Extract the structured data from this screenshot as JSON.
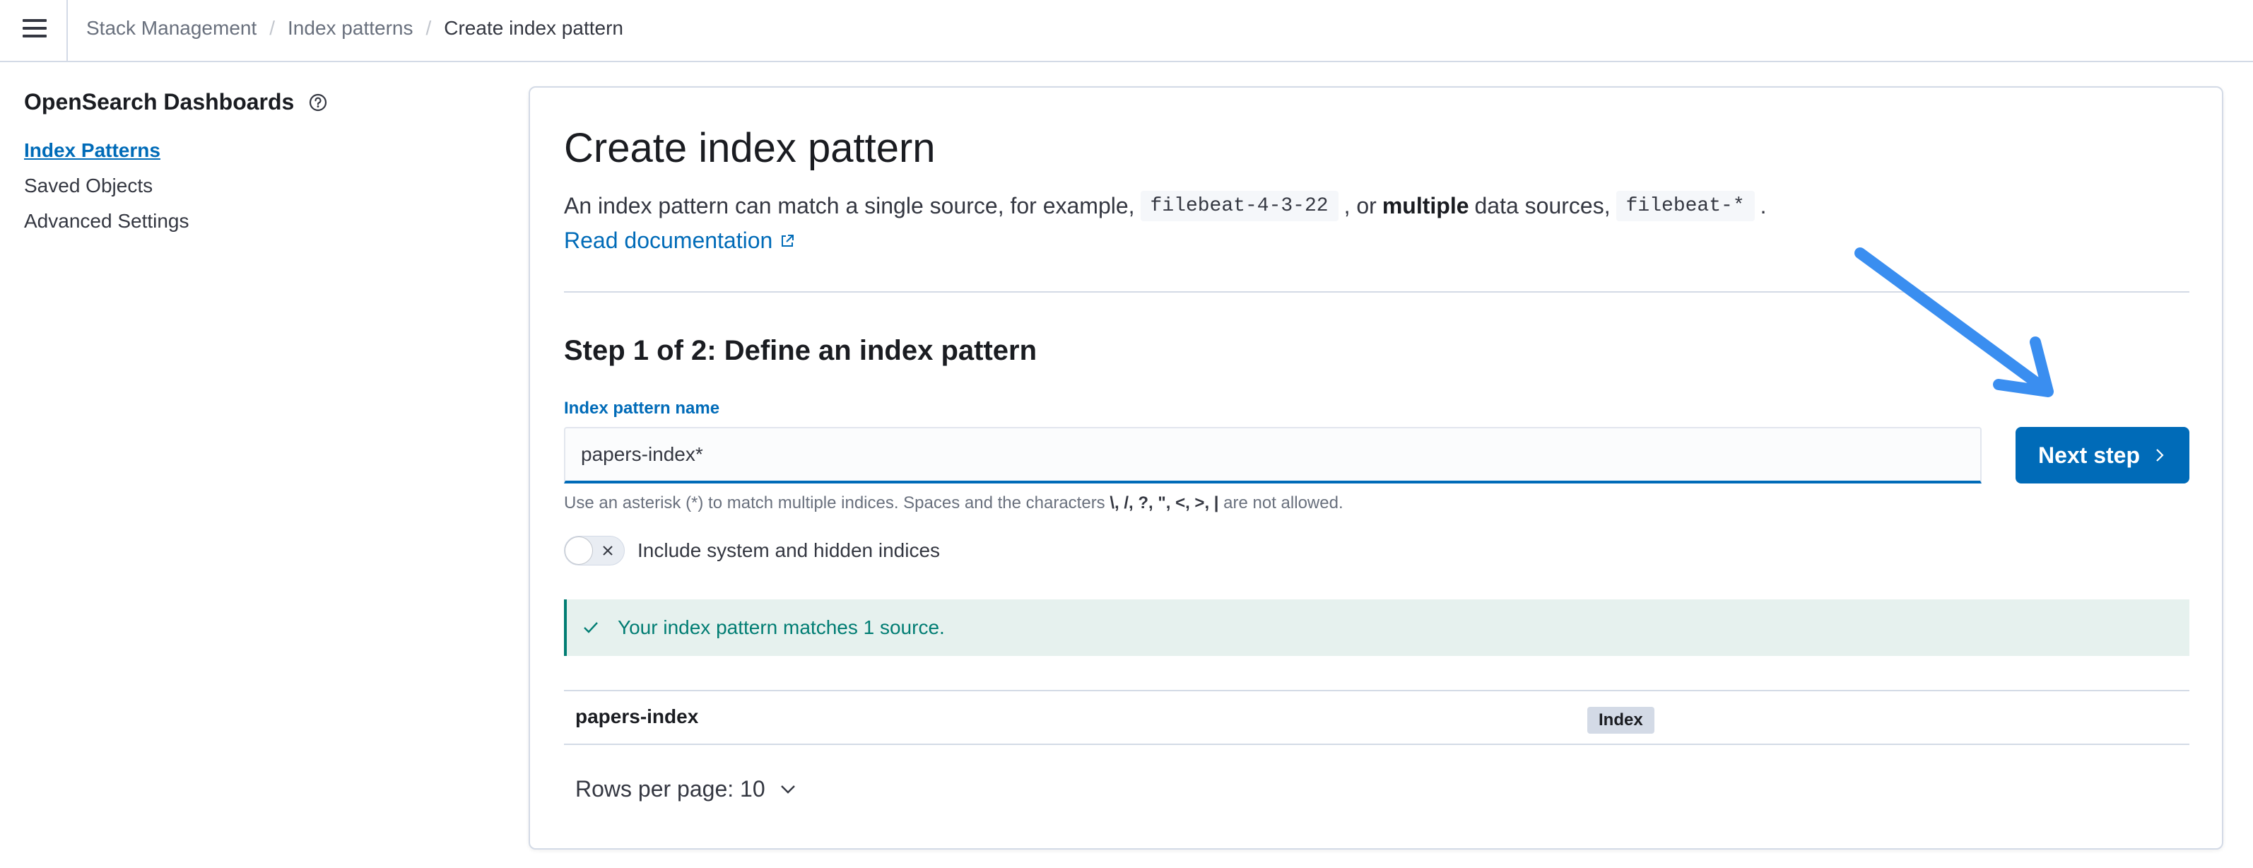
{
  "header": {
    "breadcrumbs": [
      "Stack Management",
      "Index patterns",
      "Create index pattern"
    ]
  },
  "sidebar": {
    "title": "OpenSearch Dashboards",
    "items": [
      {
        "label": "Index Patterns",
        "active": true
      },
      {
        "label": "Saved Objects",
        "active": false
      },
      {
        "label": "Advanced Settings",
        "active": false
      }
    ]
  },
  "main": {
    "title": "Create index pattern",
    "description": {
      "part1": "An index pattern can match a single source, for example,",
      "code1": "filebeat-4-3-22",
      "part2": ", or",
      "bold": "multiple",
      "part3": "data sources,",
      "code2": "filebeat-*",
      "part4": "."
    },
    "doc_link": "Read documentation",
    "step_title": "Step 1 of 2: Define an index pattern",
    "field_label": "Index pattern name",
    "field_value": "papers-index*",
    "help_text": {
      "part1": "Use an asterisk (*) to match multiple indices. Spaces and the characters",
      "chars": "\\, /, ?, \", <, >, |",
      "part2": "are not allowed."
    },
    "next_button": "Next step",
    "toggle_label": "Include system and hidden indices",
    "toggle_on": false,
    "callout": "Your index pattern matches 1 source.",
    "table": {
      "rows": [
        {
          "name": "papers-index",
          "badge": "Index"
        }
      ]
    },
    "rows_per_page": "Rows per page: 10"
  },
  "colors": {
    "primary": "#006bb8",
    "success": "#017d73",
    "annotation_arrow": "#3a8ef0"
  }
}
